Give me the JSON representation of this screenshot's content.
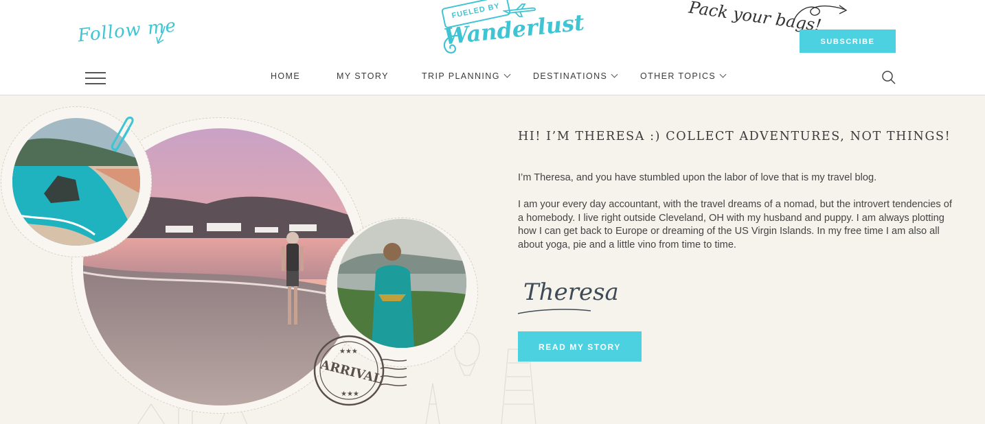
{
  "header": {
    "follow_text": "Follow me",
    "logo_top": "FUELED BY",
    "logo_main": "Wanderlust",
    "pack_text": "Pack your bags!",
    "subscribe_label": "SUBSCRIBE"
  },
  "nav": {
    "items": [
      {
        "label": "HOME",
        "dropdown": false
      },
      {
        "label": "MY STORY",
        "dropdown": false
      },
      {
        "label": "TRIP PLANNING",
        "dropdown": true
      },
      {
        "label": "DESTINATIONS",
        "dropdown": true
      },
      {
        "label": "OTHER TOPICS",
        "dropdown": true
      }
    ]
  },
  "hero": {
    "heading": "HI! I’M THERESA :) COLLECT ADVENTURES, NOT THINGS!",
    "paragraph1": "I’m Theresa, and you have stumbled upon the labor of love that is my travel blog.",
    "paragraph2": "I am your every day accountant, with the travel dreams of a nomad, but the introvert tendencies of a homebody. I live right outside Cleveland, OH with my husband and puppy. I am always plotting how I can get back to Europe or dreaming of the US Virgin Islands.  In my free time I am also all about yoga, pie and a little vino from time to time.",
    "signature": "Theresa",
    "button_label": "READ MY STORY",
    "stamp_text": "ARRIVAL"
  },
  "colors": {
    "accent": "#4cd1e1",
    "hero_bg": "#f6f2ec",
    "text": "#3b3b3b"
  }
}
